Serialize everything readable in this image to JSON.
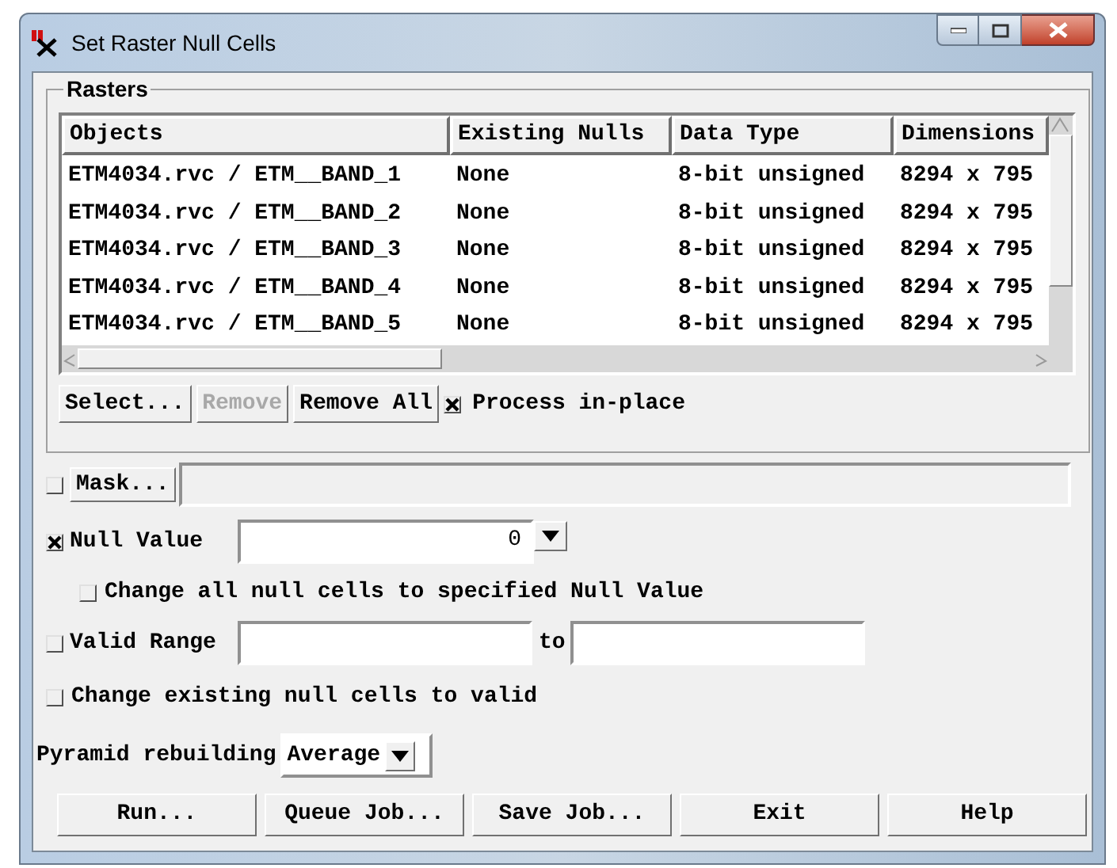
{
  "window": {
    "title": "Set Raster Null Cells"
  },
  "rasters": {
    "title": "Rasters",
    "columns": [
      "Objects",
      "Existing Nulls",
      "Data Type",
      "Dimensions"
    ],
    "rows": [
      [
        "ETM4034.rvc / ETM__BAND_1",
        "None",
        "8-bit unsigned",
        "8294 x 795"
      ],
      [
        "ETM4034.rvc / ETM__BAND_2",
        "None",
        "8-bit unsigned",
        "8294 x 795"
      ],
      [
        "ETM4034.rvc / ETM__BAND_3",
        "None",
        "8-bit unsigned",
        "8294 x 795"
      ],
      [
        "ETM4034.rvc / ETM__BAND_4",
        "None",
        "8-bit unsigned",
        "8294 x 795"
      ],
      [
        "ETM4034.rvc / ETM__BAND_5",
        "None",
        "8-bit unsigned",
        "8294 x 795"
      ]
    ],
    "buttons": [
      {
        "label": "Select...",
        "disabled": false
      },
      {
        "label": "Remove",
        "disabled": true
      },
      {
        "label": "Remove All",
        "disabled": false
      }
    ],
    "process_in_place": {
      "label": "Process in-place",
      "checked": true
    }
  },
  "mask": {
    "checked": false,
    "button": "Mask..."
  },
  "null_value": {
    "checked": true,
    "label": "Null Value",
    "value": "0"
  },
  "change_all": {
    "checked": false,
    "label": "Change all null cells to specified Null Value"
  },
  "valid_range": {
    "checked": false,
    "label": "Valid Range",
    "to_label": "to"
  },
  "change_existing": {
    "checked": false,
    "label": "Change existing null cells to valid"
  },
  "pyramid": {
    "label": "Pyramid rebuilding",
    "value": "Average"
  },
  "buttons": [
    "Run...",
    "Queue Job...",
    "Save Job...",
    "Exit",
    "Help"
  ]
}
